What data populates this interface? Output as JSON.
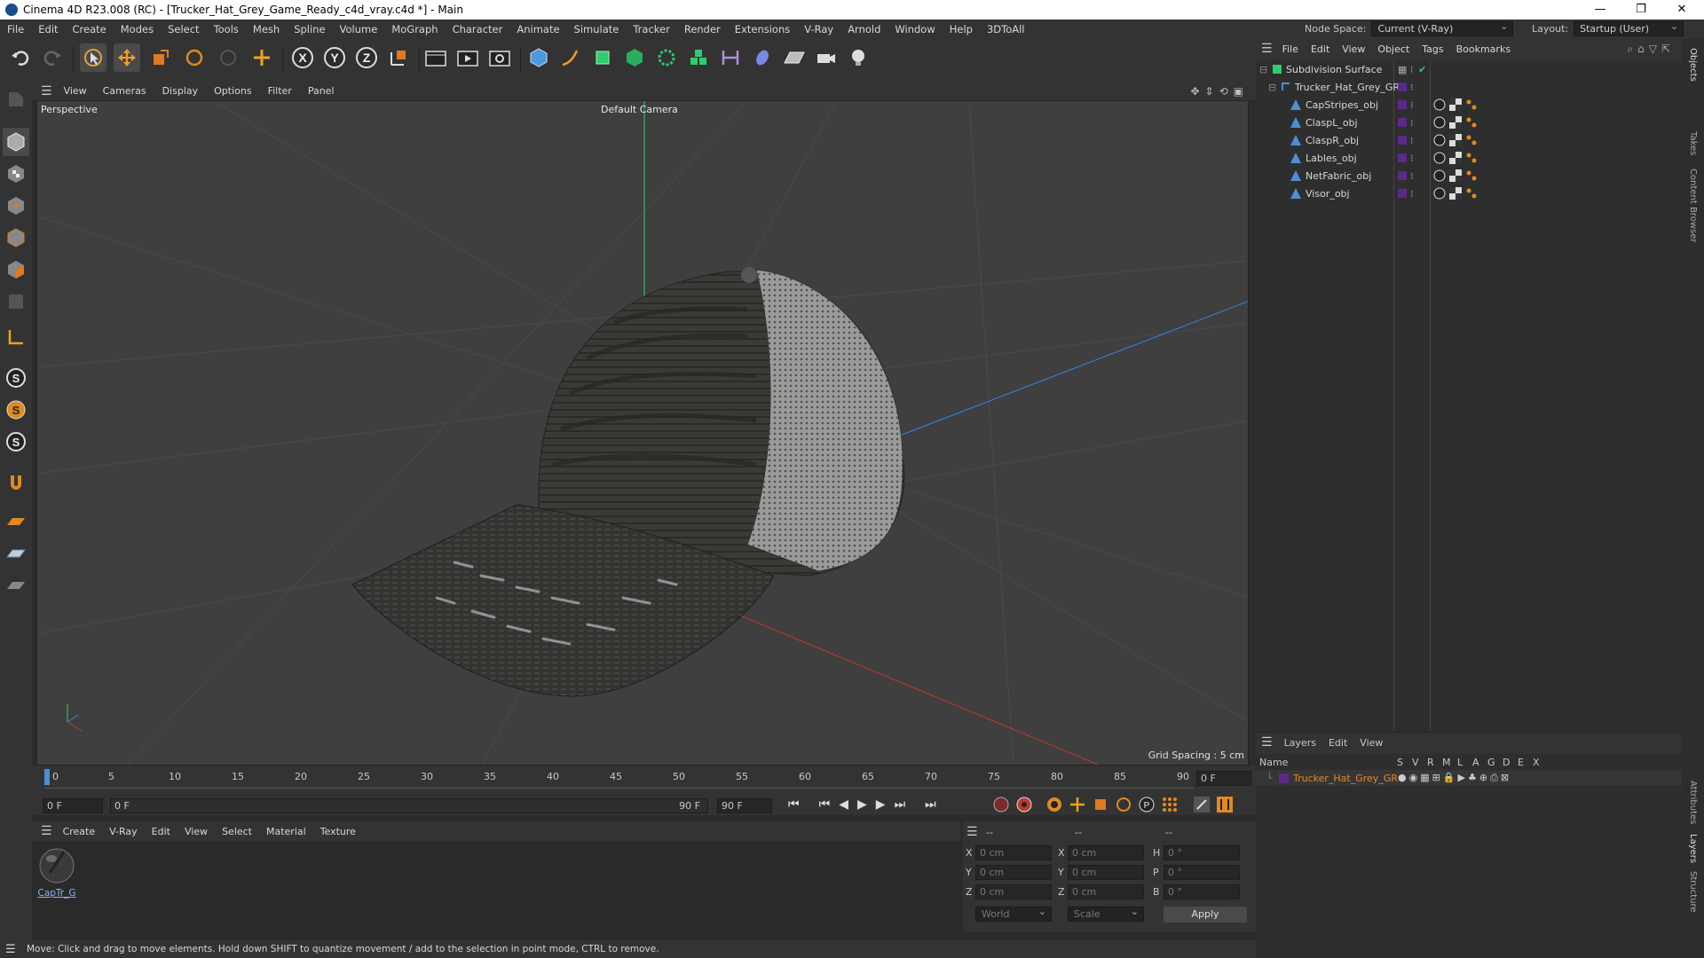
{
  "window": {
    "title": "Cinema 4D R23.008 (RC) - [Trucker_Hat_Grey_Game_Ready_c4d_vray.c4d *] - Main",
    "controls": [
      "—",
      "❐",
      "✕"
    ]
  },
  "menubar": {
    "items": [
      "File",
      "Edit",
      "Create",
      "Modes",
      "Select",
      "Tools",
      "Mesh",
      "Spline",
      "Volume",
      "MoGraph",
      "Character",
      "Animate",
      "Simulate",
      "Tracker",
      "Render",
      "Extensions",
      "V-Ray",
      "Arnold",
      "Window",
      "Help",
      "3DToAll"
    ],
    "node_space_label": "Node Space:",
    "node_space_value": "Current (V-Ray)",
    "layout_label": "Layout:",
    "layout_value": "Startup (User)"
  },
  "viewport": {
    "menu": [
      "View",
      "Cameras",
      "Display",
      "Options",
      "Filter",
      "Panel"
    ],
    "name": "Perspective",
    "camera": "Default Camera",
    "grid_spacing": "Grid Spacing : 5 cm"
  },
  "timeline": {
    "ticks": [
      "0",
      "5",
      "10",
      "15",
      "20",
      "25",
      "30",
      "35",
      "40",
      "45",
      "50",
      "55",
      "60",
      "65",
      "70",
      "75",
      "80",
      "85",
      "90"
    ],
    "current_frame_right": "0 F",
    "start_field": "0 F",
    "range_start": "0 F",
    "range_end": "90 F",
    "end_field": "90 F"
  },
  "material_manager": {
    "menu": [
      "Create",
      "V-Ray",
      "Edit",
      "View",
      "Select",
      "Material",
      "Texture"
    ],
    "material_name": "CapTr_G"
  },
  "coordinates": {
    "header": [
      "--",
      "--",
      "--"
    ],
    "rows": [
      {
        "a": "X",
        "av": "0 cm",
        "b": "X",
        "bv": "0 cm",
        "c": "H",
        "cv": "0 °"
      },
      {
        "a": "Y",
        "av": "0 cm",
        "b": "Y",
        "bv": "0 cm",
        "c": "P",
        "cv": "0 °"
      },
      {
        "a": "Z",
        "av": "0 cm",
        "b": "Z",
        "bv": "0 cm",
        "c": "B",
        "cv": "0 °"
      }
    ],
    "mode1": "World",
    "mode2": "Scale",
    "apply": "Apply"
  },
  "object_manager": {
    "menu": [
      "File",
      "Edit",
      "View",
      "Object",
      "Tags",
      "Bookmarks"
    ],
    "objects": [
      {
        "name": "Subdivision Surface",
        "level": 0
      },
      {
        "name": "Trucker_Hat_Grey_GR",
        "level": 1
      },
      {
        "name": "CapStripes_obj",
        "level": 2
      },
      {
        "name": "ClaspL_obj",
        "level": 2
      },
      {
        "name": "ClaspR_obj",
        "level": 2
      },
      {
        "name": "Lables_obj",
        "level": 2
      },
      {
        "name": "NetFabric_obj",
        "level": 2
      },
      {
        "name": "Visor_obj",
        "level": 2
      }
    ]
  },
  "layer_manager": {
    "menu": [
      "Layers",
      "Edit",
      "View"
    ],
    "columns_name": "Name",
    "columns": [
      "S",
      "V",
      "R",
      "M",
      "L",
      "A",
      "G",
      "D",
      "E",
      "X"
    ],
    "layer_name": "Trucker_Hat_Grey_GR",
    "layer_color": "#5a2a8a"
  },
  "side_tabs": [
    "Objects",
    "Takes",
    "Content Browser",
    "Attributes",
    "Layers",
    "Structure"
  ],
  "status": "Move: Click and drag to move elements. Hold down SHIFT to quantize movement / add to the selection in point mode, CTRL to remove.",
  "colors": {
    "accent_blue": "#4a8fd8",
    "layer_orange": "#e08a2a",
    "axis_red": "#c0392b",
    "axis_green": "#2ecc71",
    "axis_blue": "#2e86de"
  }
}
